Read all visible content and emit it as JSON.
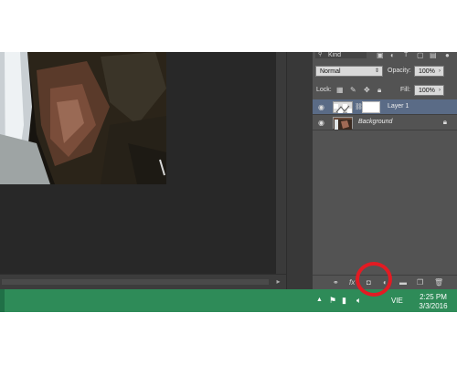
{
  "panel": {
    "kind_label": "Kind",
    "blend_mode": "Normal",
    "opacity_label": "Opacity:",
    "opacity_value": "100%",
    "lock_label": "Lock:",
    "fill_label": "Fill:",
    "fill_value": "100%",
    "filter_icons": [
      "image-filter-icon",
      "adjustment-filter-icon",
      "type-filter-icon",
      "shape-filter-icon",
      "smart-object-filter-icon",
      "filter-toggle-icon"
    ],
    "lock_icons": [
      "lock-transparent-icon",
      "lock-image-icon",
      "lock-position-icon",
      "lock-all-icon"
    ],
    "layers": [
      {
        "name": "Layer 1",
        "selected": true,
        "has_mask": true,
        "italic": false
      },
      {
        "name": "Background",
        "selected": false,
        "has_mask": false,
        "italic": true,
        "locked": true
      }
    ],
    "bottom_icons": [
      "link-layers-icon",
      "layer-style-icon",
      "add-layer-mask-icon",
      "adjustment-layer-icon",
      "new-group-icon",
      "new-layer-icon",
      "delete-layer-icon"
    ]
  },
  "taskbar": {
    "language": "VIE",
    "time": "2:25 PM",
    "date": "3/3/2016",
    "tray_icons": [
      "show-hidden-icons-icon",
      "action-center-icon",
      "network-icon",
      "volume-icon"
    ]
  },
  "colors": {
    "workspace": "#282828",
    "panel": "#535353",
    "selected_layer": "#5a6b86",
    "taskbar": "#2e8b58",
    "highlight": "#e31b23"
  }
}
